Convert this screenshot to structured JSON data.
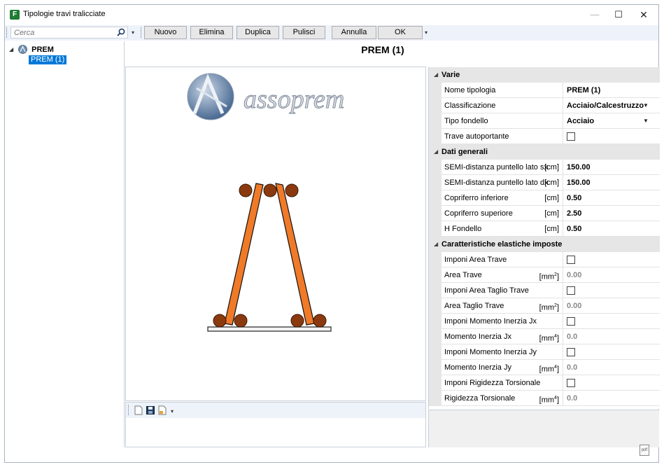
{
  "window": {
    "title": "Tipologie travi tralicciate",
    "app_icon_letter": "F",
    "minimize_glyph": "—",
    "maximize_glyph": "☐",
    "close_glyph": "✕"
  },
  "toolbar": {
    "search_placeholder": "Cerca",
    "buttons": {
      "new": "Nuovo",
      "delete": "Elimina",
      "duplicate": "Duplica",
      "clear": "Pulisci",
      "cancel": "Annulla",
      "ok": "OK"
    }
  },
  "tree": {
    "root_label": "PREM",
    "child_label": "PREM (1)"
  },
  "main": {
    "title": "PREM (1)",
    "logo_text": "assoprem"
  },
  "properties": {
    "categories": {
      "varie": "Varie",
      "dati_generali": "Dati generali",
      "caratteristiche": "Caratteristiche elastiche imposte"
    },
    "nome_tipologia": {
      "label": "Nome tipologia",
      "value": "PREM (1)"
    },
    "classificazione": {
      "label": "Classificazione",
      "value": "Acciaio/Calcestruzzo"
    },
    "tipo_fondello": {
      "label": "Tipo fondello",
      "value": "Acciaio"
    },
    "trave_autoportante": {
      "label": "Trave autoportante",
      "checked": false
    },
    "semi_sx": {
      "label": "SEMI-distanza puntello lato sx",
      "unit": "[cm]",
      "value": "150.00"
    },
    "semi_dx": {
      "label": "SEMI-distanza puntello lato dx",
      "unit": "[cm]",
      "value": "150.00"
    },
    "copriferro_inf": {
      "label": "Copriferro inferiore",
      "unit": "[cm]",
      "value": "0.50"
    },
    "copriferro_sup": {
      "label": "Copriferro superiore",
      "unit": "[cm]",
      "value": "2.50"
    },
    "h_fondello": {
      "label": "H Fondello",
      "unit": "[cm]",
      "value": "0.50"
    },
    "imponi_area": {
      "label": "Imponi Area Trave",
      "checked": false
    },
    "area_trave": {
      "label": "Area Trave",
      "unit_base": "[mm",
      "unit_exp": "2",
      "unit_end": "]",
      "value": "0.00"
    },
    "imponi_area_taglio": {
      "label": "Imponi Area Taglio Trave",
      "checked": false
    },
    "area_taglio": {
      "label": "Area Taglio Trave",
      "unit_base": "[mm",
      "unit_exp": "2",
      "unit_end": "]",
      "value": "0.00"
    },
    "imponi_jx": {
      "label": "Imponi Momento Inerzia Jx",
      "checked": false
    },
    "momento_jx": {
      "label": "Momento Inerzia Jx",
      "unit_base": "[mm",
      "unit_exp": "4",
      "unit_end": "]",
      "value": "0.0"
    },
    "imponi_jy": {
      "label": "Imponi Momento Inerzia Jy",
      "checked": false
    },
    "momento_jy": {
      "label": "Momento Inerzia Jy",
      "unit_base": "[mm",
      "unit_exp": "4",
      "unit_end": "]",
      "value": "0.0"
    },
    "imponi_torsionale": {
      "label": "Imponi Rigidezza Torsionale",
      "checked": false
    },
    "rigidezza_torsionale": {
      "label": "Rigidezza Torsionale",
      "unit_base": "[mm",
      "unit_exp": "4",
      "unit_end": "]",
      "value": "0.0"
    }
  },
  "colors": {
    "accent": "#0078d7",
    "truss_diagonal": "#f07a28",
    "rebar": "#8b3a0f",
    "toolbar_bg": "#eef3fa",
    "category_bg": "#e6e6e6"
  },
  "icons": {
    "app": "app-icon",
    "search": "search-icon",
    "tree_root": "globe-icon",
    "new_doc": "new-document-icon",
    "save": "save-icon",
    "export": "export-icon",
    "status": "pdf-icon"
  }
}
